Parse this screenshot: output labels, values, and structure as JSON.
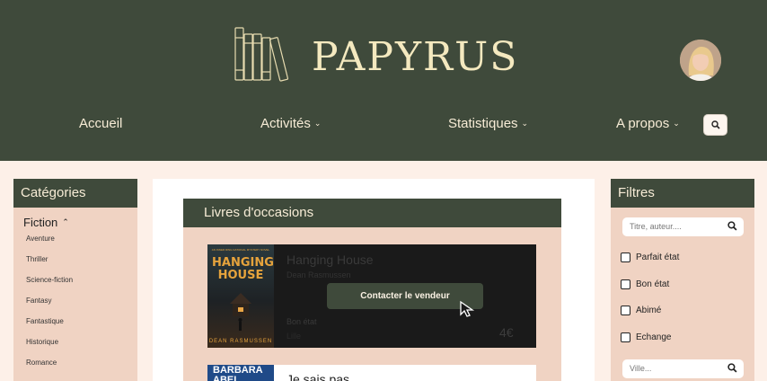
{
  "header": {
    "brand": "PAPYRUS",
    "logo_icon": "books-icon",
    "avatar_icon": "user-avatar",
    "colors": {
      "header_bg": "#3f4a3b",
      "brand": "#f4e9bf",
      "panel": "#f0d3c3",
      "page_bg": "#fdf0e8"
    }
  },
  "nav": {
    "items": [
      {
        "label": "Accueil"
      },
      {
        "label": "Activités"
      },
      {
        "label": "Statistiques"
      },
      {
        "label": "A propos"
      }
    ],
    "search_icon": "search-icon"
  },
  "categories": {
    "title": "Catégories",
    "group": "Fiction",
    "items": [
      "Aventure",
      "Thriller",
      "Science-fiction",
      "Fantasy",
      "Fantastique",
      "Historique",
      "Romance"
    ]
  },
  "listing": {
    "title": "Livres d'occasions",
    "books": [
      {
        "title": "Hanging House",
        "author": "Dean Rasmussen",
        "condition": "Bon état",
        "location": "Lille",
        "price": "4€",
        "cover_title": "HANGING HOUSE",
        "cover_author": "DEAN RASMUSSEN",
        "cover_tagline": "AN INNER RING NATIONAL MYSTERY NOVEL",
        "contact_label": "Contacter le vendeur"
      },
      {
        "title": "Je sais pas",
        "cover_title": "BARBARA ABEL"
      }
    ]
  },
  "filters": {
    "title": "Filtres",
    "search_placeholder": "Titre, auteur....",
    "city_placeholder": "Ville...",
    "options": [
      "Parfait état",
      "Bon état",
      "Abimé",
      "Echange"
    ]
  }
}
